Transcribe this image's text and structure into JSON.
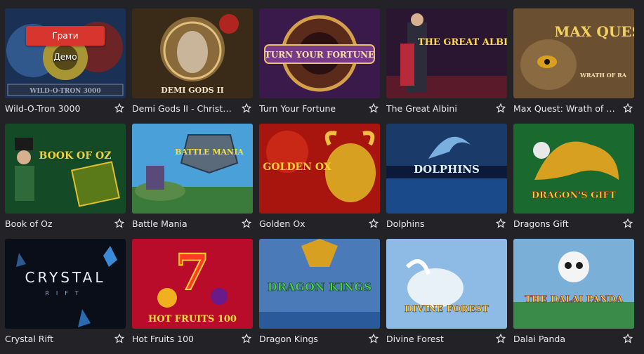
{
  "overlay": {
    "play_label": "Грати",
    "demo_label": "Демо"
  },
  "games": [
    {
      "title": "Wild-O-Tron 3000",
      "logo": "WILD-O-TRON 3000",
      "icon": "favorite-star-icon"
    },
    {
      "title": "Demi Gods II - Christm...",
      "logo": "DEMI GODS II",
      "icon": "favorite-star-icon"
    },
    {
      "title": "Turn Your Fortune",
      "logo": "TURN YOUR FORTUNE",
      "icon": "favorite-star-icon"
    },
    {
      "title": "The Great Albini",
      "logo": "THE GREAT ALBINI",
      "icon": "favorite-star-icon"
    },
    {
      "title": "Max Quest: Wrath of Ra",
      "logo": "MAX QUEST",
      "logo_sub": "WRATH OF RA",
      "icon": "favorite-star-icon"
    },
    {
      "title": "Book of Oz",
      "logo": "BOOK OF OZ",
      "icon": "favorite-star-icon"
    },
    {
      "title": "Battle Mania",
      "logo": "BATTLE MANIA",
      "icon": "favorite-star-icon"
    },
    {
      "title": "Golden Ox",
      "logo": "GOLDEN OX",
      "icon": "favorite-star-icon"
    },
    {
      "title": "Dolphins",
      "logo": "DOLPHINS",
      "icon": "favorite-star-icon"
    },
    {
      "title": "Dragons Gift",
      "logo": "DRAGON'S GIFT",
      "icon": "favorite-star-icon"
    },
    {
      "title": "Crystal Rift",
      "logo": "CRYSTAL",
      "logo_sub": "RIFT",
      "icon": "favorite-star-icon"
    },
    {
      "title": "Hot Fruits 100",
      "logo": "HOT FRUITS 100",
      "icon": "favorite-star-icon"
    },
    {
      "title": "Dragon Kings",
      "logo": "DRAGON KINGS",
      "icon": "favorite-star-icon"
    },
    {
      "title": "Divine Forest",
      "logo": "DIVINE FOREST",
      "icon": "favorite-star-icon"
    },
    {
      "title": "Dalai Panda",
      "logo": "THE DALAI PANDA",
      "icon": "favorite-star-icon"
    }
  ],
  "colors": {
    "background": "#232327",
    "play_button": "#d8352f",
    "text": "#e9e9ee"
  }
}
